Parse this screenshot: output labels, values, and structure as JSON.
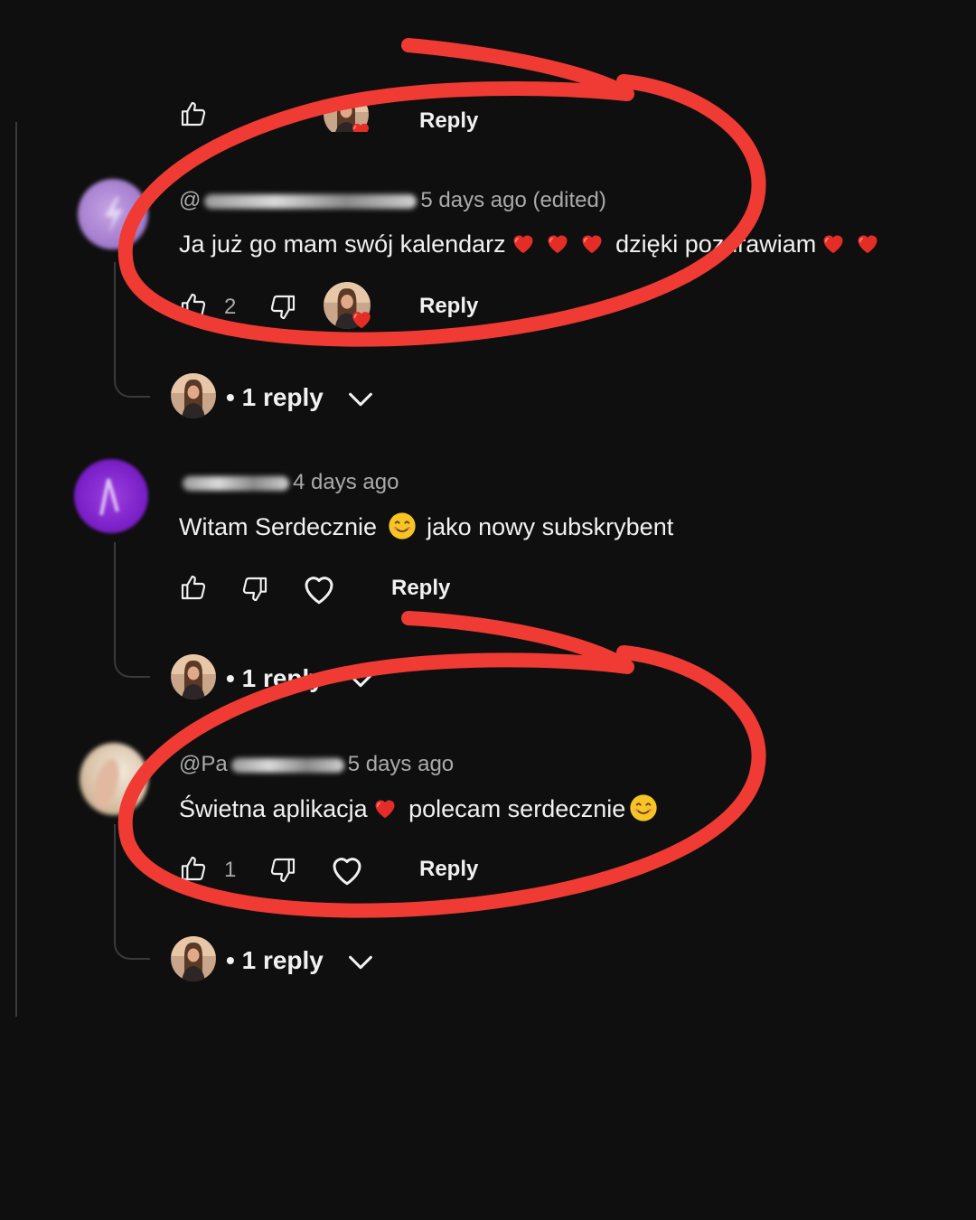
{
  "comments": [
    {
      "handle_prefix": "@",
      "time": "5 days ago (edited)",
      "text_parts": [
        "Ja już go mam swój kalendarz",
        "",
        "",
        " dzięki pozdrawiam",
        "",
        ""
      ],
      "likes": "2",
      "reply_label": "Reply",
      "replies_label": "1 reply"
    },
    {
      "handle_prefix": "",
      "time": "4 days ago",
      "text_parts": [
        "Witam Serdecznie ",
        " jako nowy subskrybent"
      ],
      "likes": "",
      "reply_label": "Reply",
      "replies_label": "1 reply"
    },
    {
      "handle_prefix": "@Pa",
      "time": "5 days ago",
      "text_parts": [
        "Świetna aplikacja",
        " polecam serdecznie"
      ],
      "likes": "1",
      "reply_label": "Reply",
      "replies_label": "1 reply"
    }
  ],
  "top_partial": {
    "reply_label": "Reply"
  },
  "colors": {
    "background": "#0f0f0f",
    "annotation": "#ef3b33",
    "muted": "#aaaaaa",
    "heart": "#e52d27"
  },
  "icons": [
    "thumbs-up-icon",
    "thumbs-down-icon",
    "heart-icon",
    "chevron-down-icon",
    "creator-heart-badge-icon",
    "smile-emoji-icon",
    "red-heart-emoji-icon"
  ]
}
